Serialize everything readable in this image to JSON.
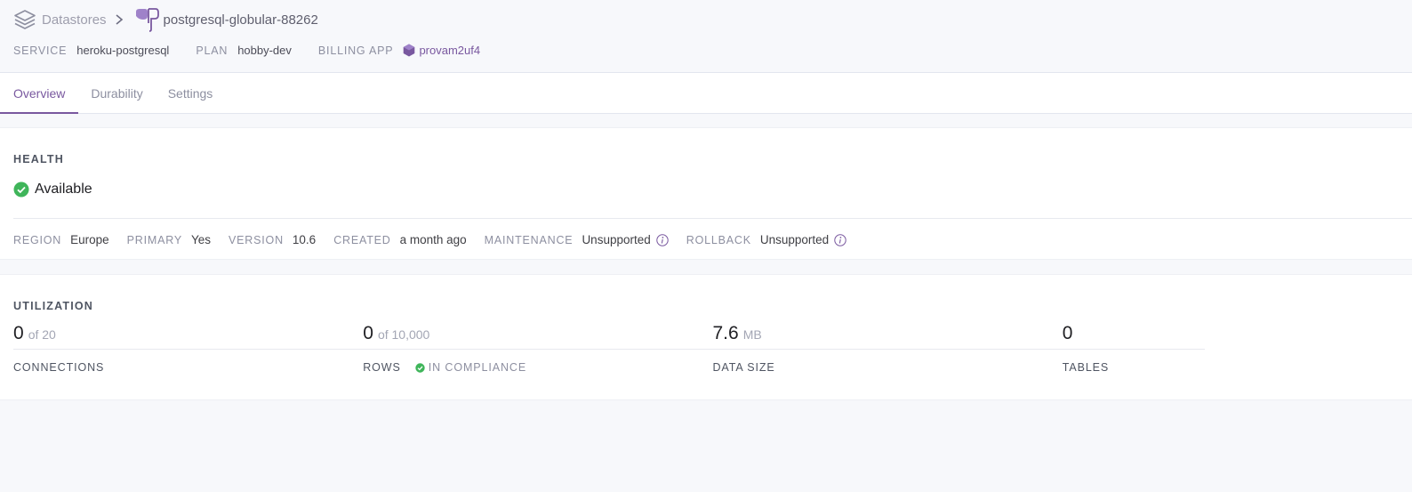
{
  "breadcrumb": {
    "datastores_label": "Datastores",
    "db_name": "postgresql-globular-88262"
  },
  "meta": {
    "service_key": "SERVICE",
    "service_value": "heroku-postgresql",
    "plan_key": "PLAN",
    "plan_value": "hobby-dev",
    "billing_key": "BILLING APP",
    "billing_value": "provam2uf4"
  },
  "tabs": [
    {
      "label": "Overview",
      "active": true
    },
    {
      "label": "Durability",
      "active": false
    },
    {
      "label": "Settings",
      "active": false
    }
  ],
  "health": {
    "title": "HEALTH",
    "status": "Available",
    "attrs": {
      "region_key": "REGION",
      "region_value": "Europe",
      "primary_key": "PRIMARY",
      "primary_value": "Yes",
      "version_key": "VERSION",
      "version_value": "10.6",
      "created_key": "CREATED",
      "created_value": "a month ago",
      "maintenance_key": "MAINTENANCE",
      "maintenance_value": "Unsupported",
      "rollback_key": "ROLLBACK",
      "rollback_value": "Unsupported"
    }
  },
  "utilization": {
    "title": "UTILIZATION",
    "connections": {
      "value": "0",
      "of": "of 20",
      "label": "CONNECTIONS"
    },
    "rows": {
      "value": "0",
      "of": "of 10,000",
      "label": "ROWS",
      "compliance": "IN COMPLIANCE"
    },
    "data_size": {
      "value": "7.6",
      "unit": "MB",
      "label": "DATA SIZE"
    },
    "tables": {
      "value": "0",
      "label": "TABLES"
    }
  },
  "colors": {
    "accent": "#79589f",
    "success": "#3fb55a"
  }
}
